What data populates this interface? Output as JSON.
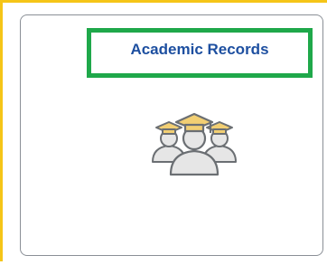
{
  "tile": {
    "title": "Academic Records",
    "icon": "graduates-icon"
  },
  "colors": {
    "title_text": "#1d4fa0",
    "highlight_box": "#1fa84a",
    "focus_border": "#f5c518",
    "tile_border": "#8a8f96",
    "icon_cap": "#f2cf73",
    "icon_outline": "#6b6f73",
    "icon_body": "#e6e6e6"
  }
}
